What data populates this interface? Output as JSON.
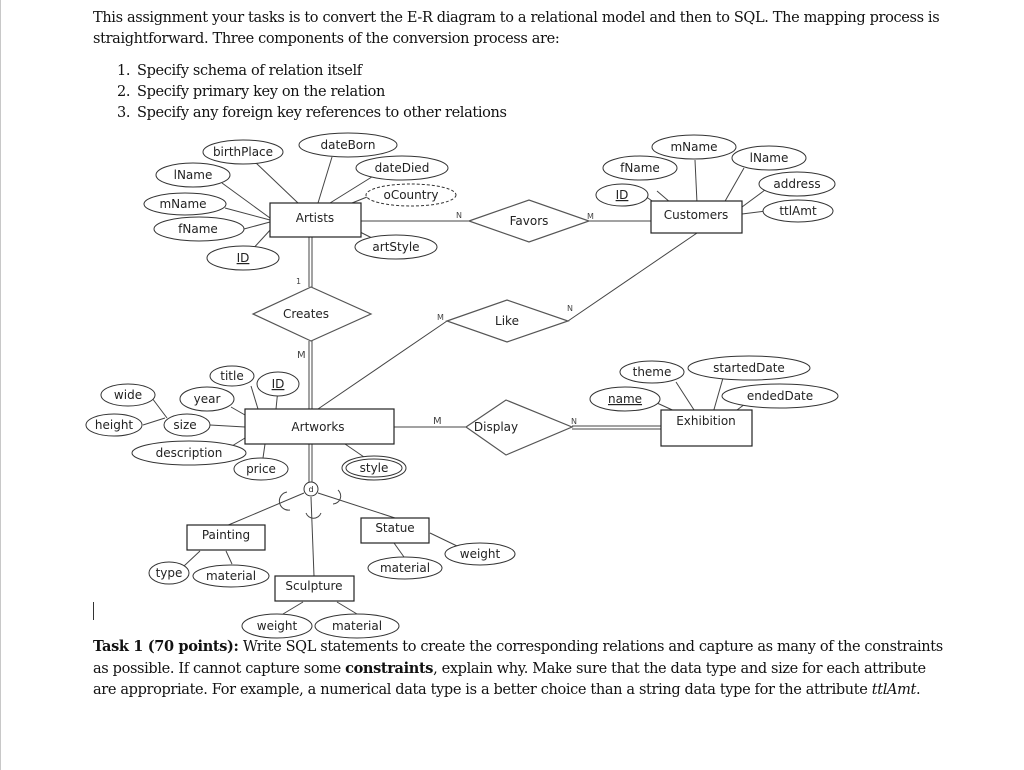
{
  "document": {
    "intro": "This assignment your tasks is to convert the E-R diagram to a relational model and then to SQL. The mapping process is straightforward.  Three components of the conversion process are:",
    "steps": [
      {
        "num": "1.",
        "text": "Specify schema of relation itself"
      },
      {
        "num": "2.",
        "text": "Specify primary key on the relation"
      },
      {
        "num": "3.",
        "text": "Specify any foreign key references to other relations"
      }
    ],
    "task": {
      "heading": "Task 1 (70 points):",
      "part1": " Write SQL statements to create the corresponding relations and capture as many of the constraints as possible.  If cannot capture some ",
      "bold_word": "constraints",
      "part2": ", explain why. Make sure that the data type and size for each attribute are appropriate.  For example, a numerical data type is a better choice than a string data type for the attribute ",
      "italic_word": "ttlAmt",
      "end": "."
    }
  },
  "diagram": {
    "entities": {
      "artists": "Artists",
      "customers": "Customers",
      "artworks": "Artworks",
      "exhibition": "Exhibition",
      "painting": "Painting",
      "sculpture": "Sculpture",
      "statue": "Statue"
    },
    "relationships": {
      "favors": "Favors",
      "creates": "Creates",
      "like": "Like",
      "display": "Display"
    },
    "specialization": "d",
    "attributes": {
      "artists": {
        "birthPlace": "birthPlace",
        "dateBorn": "dateBorn",
        "dateDied": "dateDied",
        "oCountry": "oCountry",
        "lName": "lName",
        "mName": "mName",
        "fName": "fName",
        "id": "ID",
        "artStyle": "artStyle"
      },
      "customers": {
        "mName": "mName",
        "lName": "lName",
        "fName": "fName",
        "address": "address",
        "id": "ID",
        "ttlAmt": "ttlAmt"
      },
      "artworks": {
        "title": "title",
        "id": "ID",
        "wide": "wide",
        "year": "year",
        "height": "height",
        "size": "size",
        "description": "description",
        "price": "price",
        "style": "style"
      },
      "exhibition": {
        "theme": "theme",
        "startedDate": "startedDate",
        "name": "name",
        "endedDate": "endedDate"
      },
      "painting": {
        "type": "type",
        "material": "material"
      },
      "statue": {
        "material": "material",
        "weight": "weight"
      },
      "sculpture": {
        "weight": "weight",
        "material": "material"
      }
    },
    "cardinalities": {
      "favors_artists": "N",
      "favors_customers": "M",
      "creates_artists": "1",
      "creates_artworks": "M",
      "like_artworks": "M",
      "like_customers": "N",
      "display_artworks": "M",
      "display_exhibition": "N"
    }
  }
}
